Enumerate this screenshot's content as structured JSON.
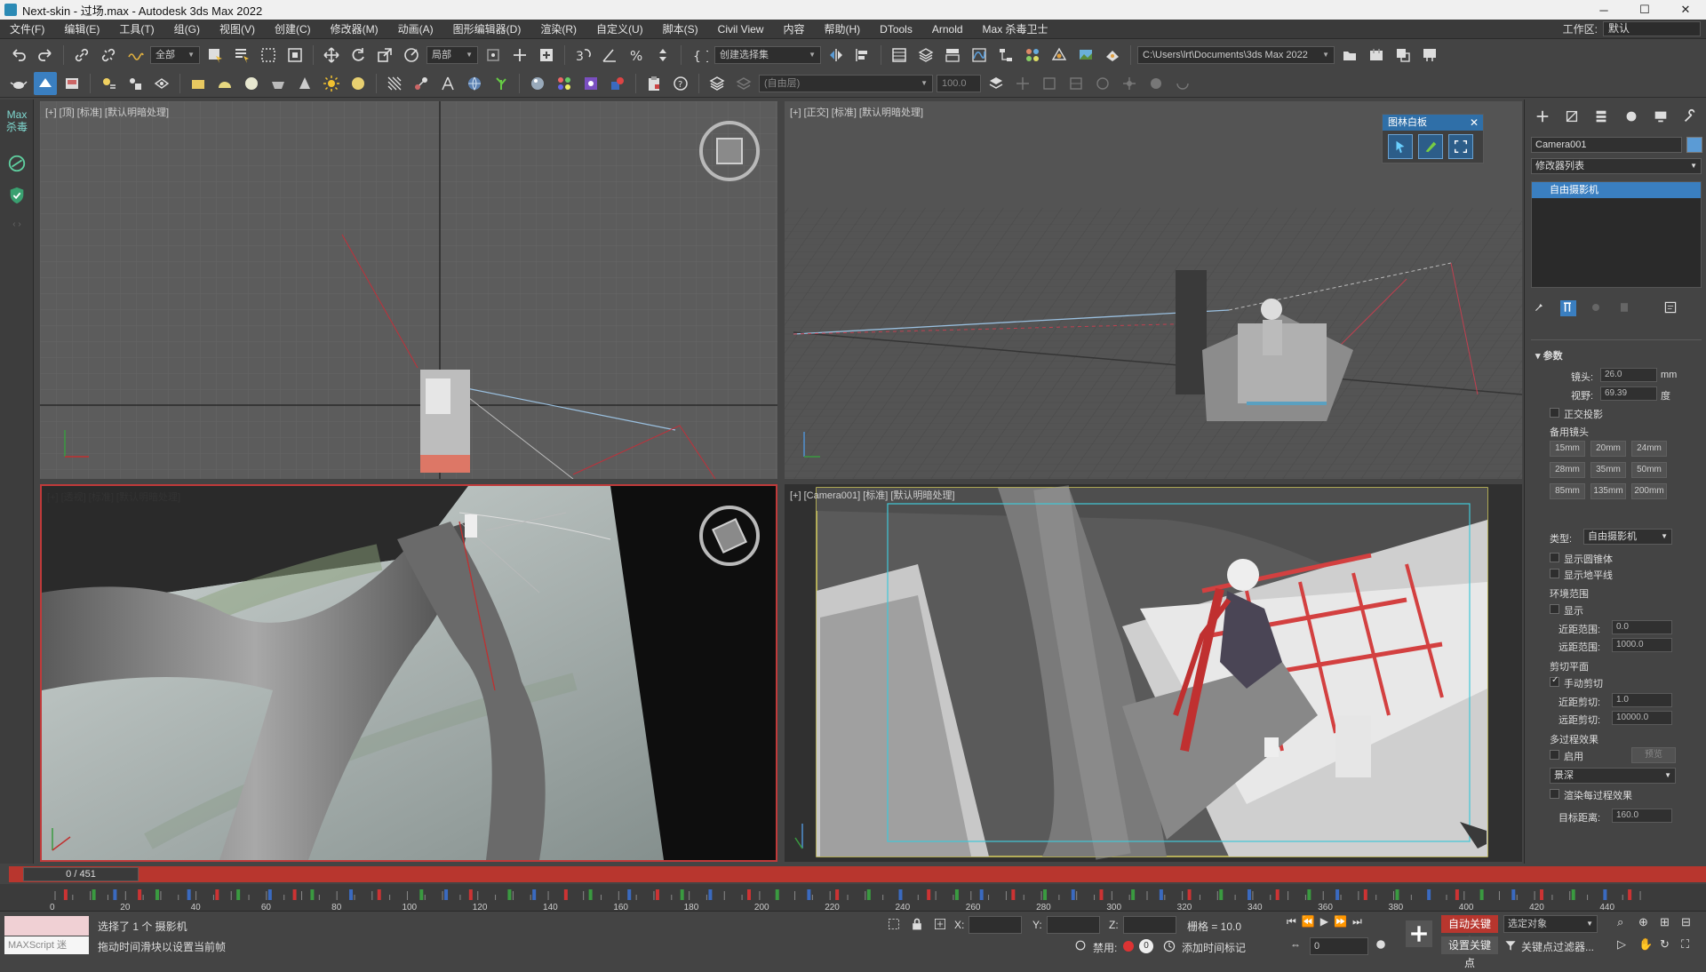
{
  "window": {
    "title": "Next-skin - 过场.max - Autodesk 3ds Max 2022",
    "minimize": "─",
    "maximize": "☐",
    "close": "✕"
  },
  "menu": {
    "items": [
      "文件(F)",
      "编辑(E)",
      "工具(T)",
      "组(G)",
      "视图(V)",
      "创建(C)",
      "修改器(M)",
      "动画(A)",
      "图形编辑器(D)",
      "渲染(R)",
      "自定义(U)",
      "脚本(S)",
      "Civil View",
      "内容",
      "帮助(H)",
      "DTools",
      "Arnold",
      "Max 杀毒卫士"
    ],
    "workspace_label": "工作区:",
    "workspace_value": "默认"
  },
  "toolbar1": {
    "selection_filter": "全部",
    "ref_coord": "局部",
    "named_selection": "创建选择集",
    "project_path": "C:\\Users\\lrt\\Documents\\3ds Max 2022"
  },
  "toolbar2": {
    "layer_field": "(自由层)",
    "value_field": "100.0"
  },
  "lefttools": {
    "badge": "Max\n杀毒"
  },
  "viewports": {
    "top": {
      "label": "[+] [顶] [标准] [默认明暗处理]"
    },
    "front": {
      "label": "[+] [正交] [标准] [默认明暗处理]"
    },
    "persp": {
      "label": "[+] [透视] [标准] [默认明暗处理]"
    },
    "camera": {
      "label": "[+] [Camera001] [标准] [默认明暗处理]"
    }
  },
  "floatpanel": {
    "title": "图林白板",
    "close": "✕"
  },
  "command_panel": {
    "object_name": "Camera001",
    "object_color": "#5b9bd5",
    "modifier_list": "修改器列表",
    "stack_item": "自由摄影机",
    "params_header": "参数",
    "lens_label": "镜头:",
    "lens_value": "26.0",
    "lens_unit": "mm",
    "fov_label": "视野:",
    "fov_value": "69.39",
    "fov_unit": "度",
    "ortho_label": "正交投影",
    "stock_lenses_label": "备用镜头",
    "stock_lenses": [
      "15mm",
      "20mm",
      "24mm",
      "28mm",
      "35mm",
      "50mm",
      "85mm",
      "135mm",
      "200mm"
    ],
    "type_label": "类型:",
    "type_value": "自由摄影机",
    "show_cone": "显示圆锥体",
    "show_horizon": "显示地平线",
    "env_range_label": "环境范围",
    "env_show": "显示",
    "near_range_label": "近距范围:",
    "near_range_value": "0.0",
    "far_range_label": "远距范围:",
    "far_range_value": "1000.0",
    "clip_label": "剪切平面",
    "manual_clip": "手动剪切",
    "near_clip_label": "近距剪切:",
    "near_clip_value": "1.0",
    "far_clip_label": "远距剪切:",
    "far_clip_value": "10000.0",
    "multipass_label": "多过程效果",
    "enable_label": "启用",
    "preview_label": "预览",
    "effect_value": "景深",
    "render_each_pass": "渲染每过程效果",
    "target_dist_label": "目标距离:",
    "target_dist_value": "160.0"
  },
  "timeline": {
    "frame_display": "0 / 451",
    "ticks": [
      "0",
      "20",
      "40",
      "60",
      "80",
      "100",
      "120",
      "140",
      "160",
      "180",
      "200",
      "220",
      "240",
      "260",
      "280",
      "300",
      "320",
      "340",
      "360",
      "380",
      "400",
      "420",
      "440"
    ]
  },
  "status": {
    "maxscript_label": "MAXScript 迷",
    "selected_text": "选择了 1 个 摄影机",
    "prompt_text": "拖动时间滑块以设置当前帧",
    "x_label": "X:",
    "y_label": "Y:",
    "z_label": "Z:",
    "grid_text": "栅格 = 10.0",
    "disable_label": "禁用:",
    "add_time_tag": "添加时间标记",
    "auto_key": "自动关键点",
    "selected_obj": "选定对象",
    "set_key": "设置关键点",
    "key_filters": "关键点过滤器...",
    "frame_field": "0"
  }
}
